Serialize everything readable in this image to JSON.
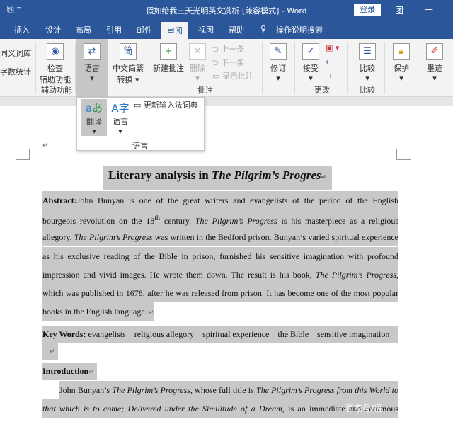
{
  "window": {
    "title": "假如给我三天光明英文赏析 [兼容模式] - Word",
    "login": "登录",
    "restore": "团",
    "minimize": "—"
  },
  "tabs": [
    "插入",
    "设计",
    "布局",
    "引用",
    "邮件",
    "审阅",
    "视图",
    "帮助",
    "操作说明搜索"
  ],
  "active_tab": "审阅",
  "ribbon": {
    "thesaurus": "同义词库",
    "wordcount": "字数统计",
    "accessibility": {
      "l1": "检查",
      "l2": "辅助功能",
      "group": "辅助功能"
    },
    "language": "语言",
    "chinese_convert": {
      "l1": "中文简繁",
      "l2": "转换"
    },
    "comments": {
      "new": "新建批注",
      "delete": "删除",
      "prev": "上一条",
      "next": "下一条",
      "show": "显示批注",
      "group": "批注"
    },
    "track": "修订",
    "accept": "接受",
    "changes_group": "更改",
    "compare": "比较",
    "compare_group": "比较",
    "protect": "保护",
    "ink": "墨迹"
  },
  "popup": {
    "translate": "翻译",
    "language": "语言",
    "update_ime": "更新输入法词典",
    "group": "语言"
  },
  "document": {
    "title_plain": "Literary analysis in ",
    "title_italic": "The Pilgrim’s Progres",
    "abstract": [
      [
        "Abstract:",
        "John Bunyan is one of the great writers and evangelists of the period of the English"
      ],
      [
        "bourgeois revolution on the 18",
        "th",
        " century. ",
        "The Pilgrim’s Progress",
        " is his masterpiece as a religious"
      ],
      [
        "allegory. ",
        "The Pilgrim’s Progress",
        " was written in the Bedford prison. Bunyan’s varied spiritual experience"
      ],
      [
        "as his exclusive reading of the Bible in prison, furnished his sensitive imagination with profound"
      ],
      [
        "impression and vivid images. He wrote them down. The result is his book, ",
        "The Pilgrim’s Progress,"
      ],
      [
        "which was published in 1678, after he was released from prison. It has become one of the most popular"
      ],
      [
        "books in the English language."
      ]
    ],
    "keywords_label": "Key Words:",
    "keywords": "evangelists    religious allegory    spiritual experience    the Bible    sensitive imagination",
    "intro_heading": "Introduction",
    "intro": [
      [
        "John Bunyan’s ",
        "The Pilgrim’s Progress,",
        " whose full title is ",
        "The Pilgrim’s Progress from this World to"
      ],
      [
        "that which is to come; Delivered under the Similitude of a Dream,",
        " is an immediate and enormous"
      ]
    ],
    "watermark": "百家号/语"
  }
}
